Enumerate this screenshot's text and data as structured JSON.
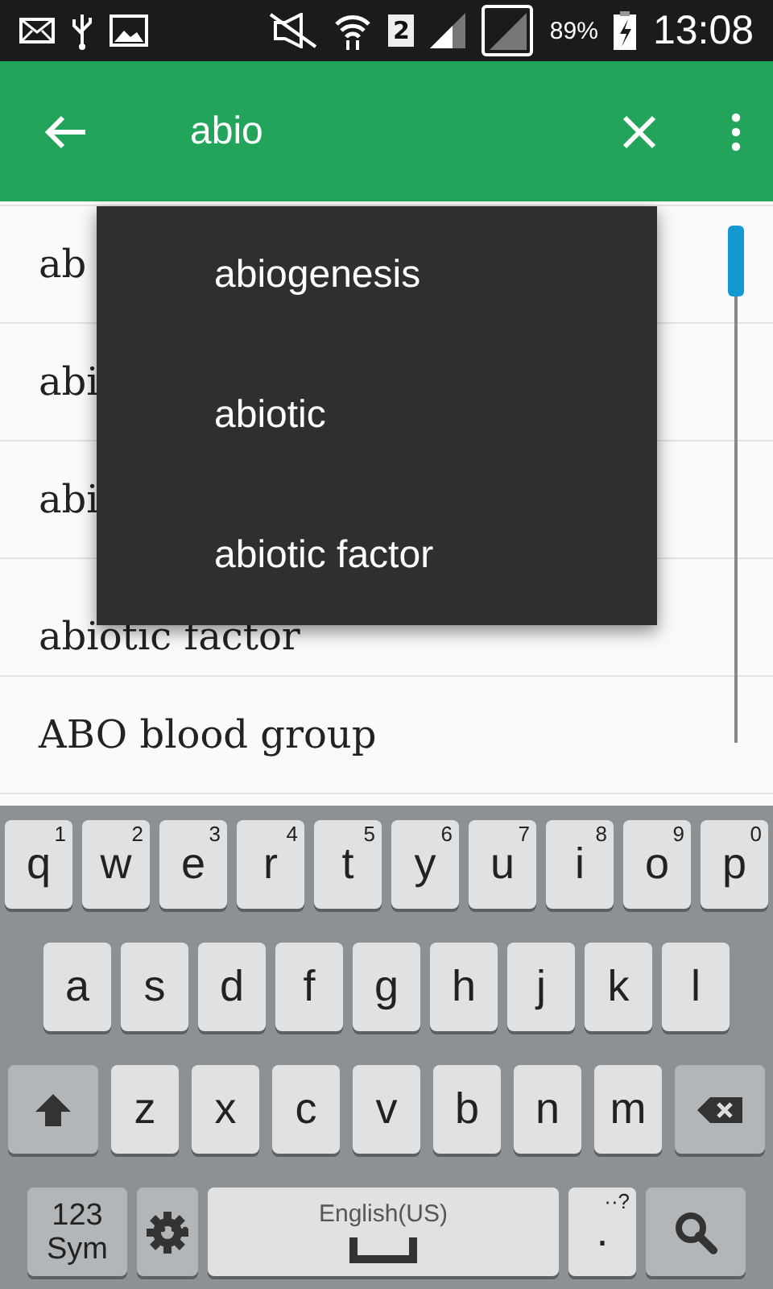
{
  "status_bar": {
    "sim": "2",
    "battery": "89%",
    "time": "13:08"
  },
  "search_bar": {
    "query": "abio"
  },
  "results": [
    {
      "text": "ab"
    },
    {
      "text": "abi"
    },
    {
      "text": "abi"
    },
    {
      "text": "abiotic factor"
    },
    {
      "text": "ABO blood group"
    }
  ],
  "suggestions": [
    {
      "text": "abiogenesis"
    },
    {
      "text": "abiotic"
    },
    {
      "text": "abiotic factor"
    }
  ],
  "keyboard": {
    "rows": [
      [
        {
          "kind": "letter",
          "label": "q",
          "hint": "1"
        },
        {
          "kind": "letter",
          "label": "w",
          "hint": "2"
        },
        {
          "kind": "letter",
          "label": "e",
          "hint": "3"
        },
        {
          "kind": "letter",
          "label": "r",
          "hint": "4"
        },
        {
          "kind": "letter",
          "label": "t",
          "hint": "5"
        },
        {
          "kind": "letter",
          "label": "y",
          "hint": "6"
        },
        {
          "kind": "letter",
          "label": "u",
          "hint": "7"
        },
        {
          "kind": "letter",
          "label": "i",
          "hint": "8"
        },
        {
          "kind": "letter",
          "label": "o",
          "hint": "9"
        },
        {
          "kind": "letter",
          "label": "p",
          "hint": "0"
        }
      ],
      [
        {
          "kind": "letter",
          "label": "a"
        },
        {
          "kind": "letter",
          "label": "s"
        },
        {
          "kind": "letter",
          "label": "d"
        },
        {
          "kind": "letter",
          "label": "f"
        },
        {
          "kind": "letter",
          "label": "g"
        },
        {
          "kind": "letter",
          "label": "h"
        },
        {
          "kind": "letter",
          "label": "j"
        },
        {
          "kind": "letter",
          "label": "k"
        },
        {
          "kind": "letter",
          "label": "l"
        }
      ],
      [
        {
          "kind": "shift"
        },
        {
          "kind": "letter",
          "label": "z"
        },
        {
          "kind": "letter",
          "label": "x"
        },
        {
          "kind": "letter",
          "label": "c"
        },
        {
          "kind": "letter",
          "label": "v"
        },
        {
          "kind": "letter",
          "label": "b"
        },
        {
          "kind": "letter",
          "label": "n"
        },
        {
          "kind": "letter",
          "label": "m"
        },
        {
          "kind": "backspace"
        }
      ]
    ],
    "bottom_keys": [
      {
        "kind": "sym",
        "label": "123\nSym"
      },
      {
        "kind": "settings"
      },
      {
        "kind": "space",
        "label": "English(US)"
      },
      {
        "kind": "letter",
        "label": ".",
        "hint": "··?"
      },
      {
        "kind": "search"
      }
    ]
  }
}
